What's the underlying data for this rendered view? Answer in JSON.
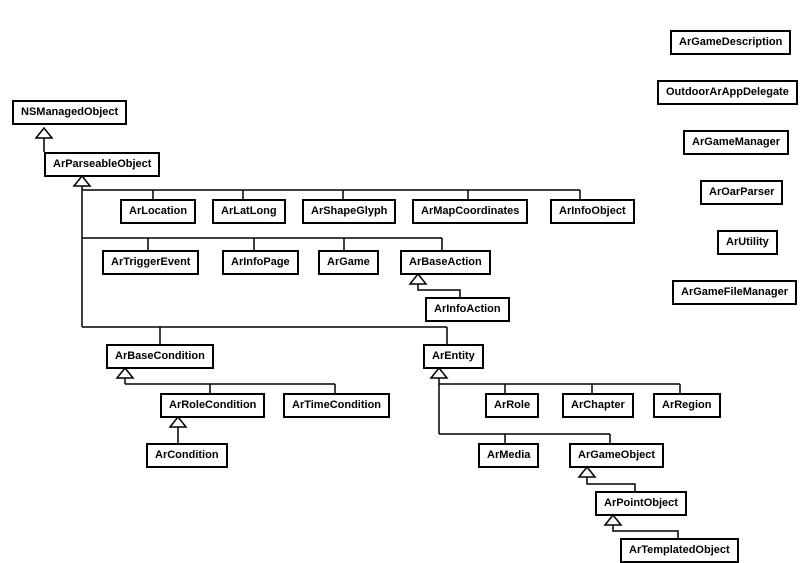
{
  "classes": {
    "nsManagedObject": "NSManagedObject",
    "arParseableObject": "ArParseableObject",
    "arLocation": "ArLocation",
    "arLatLong": "ArLatLong",
    "arShapeGlyph": "ArShapeGlyph",
    "arMapCoordinates": "ArMapCoordinates",
    "arInfoObject": "ArInfoObject",
    "arTriggerEvent": "ArTriggerEvent",
    "arInfoPage": "ArInfoPage",
    "arGame": "ArGame",
    "arBaseAction": "ArBaseAction",
    "arInfoAction": "ArInfoAction",
    "arBaseCondition": "ArBaseCondition",
    "arRoleCondition": "ArRoleCondition",
    "arTimeCondition": "ArTimeCondition",
    "arCondition": "ArCondition",
    "arEntity": "ArEntity",
    "arRole": "ArRole",
    "arChapter": "ArChapter",
    "arRegion": "ArRegion",
    "arMedia": "ArMedia",
    "arGameObject": "ArGameObject",
    "arPointObject": "ArPointObject",
    "arTemplatedObject": "ArTemplatedObject"
  },
  "standalone": {
    "arGameDescription": "ArGameDescription",
    "outdoorArAppDelegate": "OutdoorArAppDelegate",
    "arGameManager": "ArGameManager",
    "arOarParser": "ArOarParser",
    "arUtility": "ArUtility",
    "arGameFileManager": "ArGameFileManager"
  },
  "chart_data": {
    "type": "diagram",
    "title": "",
    "nodes": [
      "NSManagedObject",
      "ArParseableObject",
      "ArLocation",
      "ArLatLong",
      "ArShapeGlyph",
      "ArMapCoordinates",
      "ArInfoObject",
      "ArTriggerEvent",
      "ArInfoPage",
      "ArGame",
      "ArBaseAction",
      "ArInfoAction",
      "ArBaseCondition",
      "ArRoleCondition",
      "ArTimeCondition",
      "ArCondition",
      "ArEntity",
      "ArRole",
      "ArChapter",
      "ArRegion",
      "ArMedia",
      "ArGameObject",
      "ArPointObject",
      "ArTemplatedObject",
      "ArGameDescription",
      "OutdoorArAppDelegate",
      "ArGameManager",
      "ArOarParser",
      "ArUtility",
      "ArGameFileManager"
    ],
    "edges": [
      {
        "from": "ArParseableObject",
        "to": "NSManagedObject",
        "type": "inherits"
      },
      {
        "from": "ArLocation",
        "to": "ArParseableObject",
        "type": "inherits"
      },
      {
        "from": "ArLatLong",
        "to": "ArParseableObject",
        "type": "inherits"
      },
      {
        "from": "ArShapeGlyph",
        "to": "ArParseableObject",
        "type": "inherits"
      },
      {
        "from": "ArMapCoordinates",
        "to": "ArParseableObject",
        "type": "inherits"
      },
      {
        "from": "ArInfoObject",
        "to": "ArParseableObject",
        "type": "inherits"
      },
      {
        "from": "ArTriggerEvent",
        "to": "ArParseableObject",
        "type": "inherits"
      },
      {
        "from": "ArInfoPage",
        "to": "ArParseableObject",
        "type": "inherits"
      },
      {
        "from": "ArGame",
        "to": "ArParseableObject",
        "type": "inherits"
      },
      {
        "from": "ArBaseAction",
        "to": "ArParseableObject",
        "type": "inherits"
      },
      {
        "from": "ArInfoAction",
        "to": "ArBaseAction",
        "type": "inherits"
      },
      {
        "from": "ArBaseCondition",
        "to": "ArParseableObject",
        "type": "inherits"
      },
      {
        "from": "ArEntity",
        "to": "ArParseableObject",
        "type": "inherits"
      },
      {
        "from": "ArRoleCondition",
        "to": "ArBaseCondition",
        "type": "inherits"
      },
      {
        "from": "ArTimeCondition",
        "to": "ArBaseCondition",
        "type": "inherits"
      },
      {
        "from": "ArCondition",
        "to": "ArRoleCondition",
        "type": "inherits"
      },
      {
        "from": "ArRole",
        "to": "ArEntity",
        "type": "inherits"
      },
      {
        "from": "ArChapter",
        "to": "ArEntity",
        "type": "inherits"
      },
      {
        "from": "ArRegion",
        "to": "ArEntity",
        "type": "inherits"
      },
      {
        "from": "ArMedia",
        "to": "ArEntity",
        "type": "inherits"
      },
      {
        "from": "ArGameObject",
        "to": "ArEntity",
        "type": "inherits"
      },
      {
        "from": "ArPointObject",
        "to": "ArGameObject",
        "type": "inherits"
      },
      {
        "from": "ArTemplatedObject",
        "to": "ArPointObject",
        "type": "inherits"
      }
    ]
  }
}
